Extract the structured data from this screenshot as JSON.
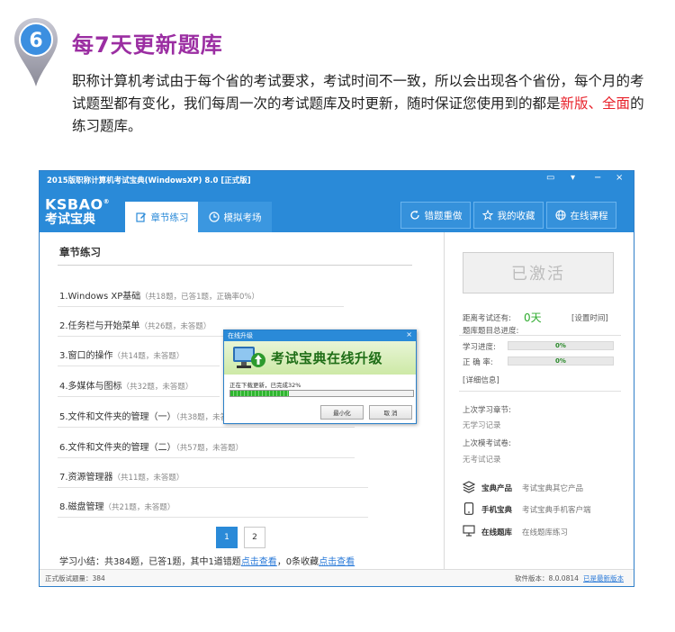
{
  "promo": {
    "badge_number": "6",
    "title": "每7天更新题库",
    "body_part1": "职称计算机考试由于每个省的考试要求，考试时间不一致，所以会出现各个省份，每个月的考试题型都有变化，我们每周一次的考试题库及时更新，随时保证您使用到的都是",
    "body_red1": "新版",
    "body_sep": "、",
    "body_red2": "全面",
    "body_end": "的练习题库。"
  },
  "window": {
    "title": "2015版职称计算机考试宝典(WindowsXP) 8.0 [正式版]",
    "controls": [
      "▭",
      "▾",
      "−",
      "×"
    ],
    "logo_top": "KSBAO",
    "logo_reg": "®",
    "logo_bottom": "考试宝典",
    "tabs": [
      {
        "label": "章节练习",
        "icon": "edit-icon"
      },
      {
        "label": "模拟考场",
        "icon": "clock-icon"
      }
    ],
    "top_buttons": [
      {
        "label": "错题重做",
        "icon": "refresh-icon"
      },
      {
        "label": "我的收藏",
        "icon": "star-icon"
      },
      {
        "label": "在线课程",
        "icon": "globe-icon"
      }
    ]
  },
  "chapters": {
    "title": "章节练习",
    "items": [
      {
        "name": "1.Windows XP基础",
        "stat": "（共18题，已答1题，正确率0%）"
      },
      {
        "name": "2.任务栏与开始菜单",
        "stat": "（共26题，未答题）"
      },
      {
        "name": "3.窗口的操作",
        "stat": "（共14题，未答题）"
      },
      {
        "name": "4.多媒体与图标",
        "stat": "（共32题，未答题）"
      },
      {
        "name": "5.文件和文件夹的管理（一）",
        "stat": "（共38题，未答题）"
      },
      {
        "name": "6.文件和文件夹的管理（二）",
        "stat": "（共57题，未答题）"
      },
      {
        "name": "7.资源管理器",
        "stat": "（共11题，未答题）"
      },
      {
        "name": "8.磁盘管理",
        "stat": "（共21题，未答题）"
      }
    ],
    "pages": [
      "1",
      "2"
    ],
    "current_page": "1",
    "summary_text": "学习小结：共384题，已答1题，其中1道错题",
    "summary_link1": "点击查看",
    "summary_mid": "，0条收藏",
    "summary_link2": "点击查看"
  },
  "right_panel": {
    "activated_label": "已激活",
    "exam_countdown_label": "距离考试还有:",
    "exam_countdown_value": "0天",
    "set_time_link": "[设置时间]",
    "progress_title": "题库题目总进度:",
    "study_progress_label": "学习进度:",
    "study_progress_value": "0%",
    "accuracy_label": "正 确 率:",
    "accuracy_value": "0%",
    "detail_link": "[详细信息]",
    "last_chapter_label": "上次学习章节:",
    "last_chapter_value": "无学习记录",
    "last_exam_label": "上次模考试卷:",
    "last_exam_value": "无考试记录",
    "links": [
      {
        "title": "宝典产品",
        "desc": "考试宝典其它产品",
        "icon": "layers-icon"
      },
      {
        "title": "手机宝典",
        "desc": "考试宝典手机客户端",
        "icon": "phone-icon"
      },
      {
        "title": "在线题库",
        "desc": "在线题库练习",
        "icon": "monitor-icon"
      }
    ]
  },
  "status": {
    "left": "正式版试题量：384",
    "version": "软件版本：8.0.0814",
    "latest": "已是最新版本"
  },
  "dialog": {
    "title": "在线升级",
    "close": "×",
    "banner": "考试宝典在线升级",
    "message": "正在下载更新，已完成32%",
    "progress": 0.32,
    "minimize_label": "最小化",
    "cancel_label": "取 消"
  }
}
